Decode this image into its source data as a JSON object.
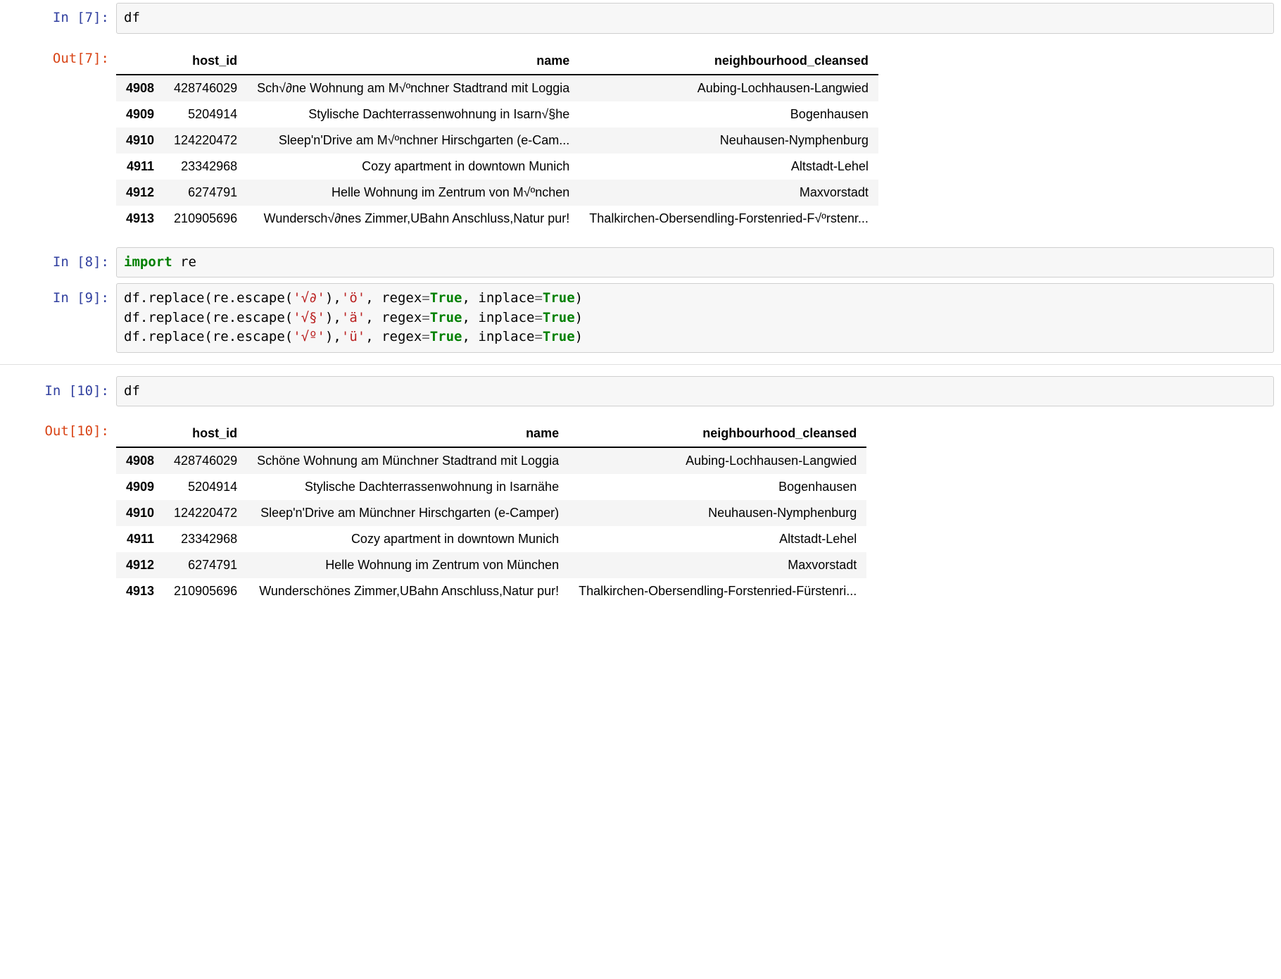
{
  "cells": {
    "c0": {
      "in_prompt": "In [7]:",
      "code_plain": "df",
      "out_prompt": "Out[7]:",
      "table": {
        "columns": [
          "host_id",
          "name",
          "neighbourhood_cleansed"
        ],
        "index": [
          "4908",
          "4909",
          "4910",
          "4911",
          "4912",
          "4913"
        ],
        "rows": [
          [
            "428746029",
            "Sch√∂ne Wohnung am M√ºnchner Stadtrand mit Loggia",
            "Aubing-Lochhausen-Langwied"
          ],
          [
            "5204914",
            "Stylische Dachterrassenwohnung in Isarn√§he",
            "Bogenhausen"
          ],
          [
            "124220472",
            "Sleep'n'Drive am M√ºnchner Hirschgarten (e-Cam...",
            "Neuhausen-Nymphenburg"
          ],
          [
            "23342968",
            "Cozy apartment in downtown Munich",
            "Altstadt-Lehel"
          ],
          [
            "6274791",
            "Helle Wohnung im Zentrum von M√ºnchen",
            "Maxvorstadt"
          ],
          [
            "210905696",
            "Wundersch√∂nes Zimmer,UBahn Anschluss,Natur pur!",
            "Thalkirchen-Obersendling-Forstenried-F√ºrstenr..."
          ]
        ]
      }
    },
    "c1": {
      "in_prompt": "In [8]:",
      "code_tokens": [
        {
          "t": "import",
          "cls": "tok-keyword"
        },
        {
          "t": " re",
          "cls": ""
        }
      ]
    },
    "c2": {
      "in_prompt": "In [9]:",
      "code_lines": [
        [
          {
            "t": "df.replace(re.escape(",
            "cls": ""
          },
          {
            "t": "'√∂'",
            "cls": "tok-string"
          },
          {
            "t": "),",
            "cls": ""
          },
          {
            "t": "'ö'",
            "cls": "tok-string"
          },
          {
            "t": ", regex",
            "cls": ""
          },
          {
            "t": "=",
            "cls": "tok-op"
          },
          {
            "t": "True",
            "cls": "tok-bool"
          },
          {
            "t": ", inplace",
            "cls": ""
          },
          {
            "t": "=",
            "cls": "tok-op"
          },
          {
            "t": "True",
            "cls": "tok-bool"
          },
          {
            "t": ")",
            "cls": ""
          }
        ],
        [
          {
            "t": "df.replace(re.escape(",
            "cls": ""
          },
          {
            "t": "'√§'",
            "cls": "tok-string"
          },
          {
            "t": "),",
            "cls": ""
          },
          {
            "t": "'ä'",
            "cls": "tok-string"
          },
          {
            "t": ", regex",
            "cls": ""
          },
          {
            "t": "=",
            "cls": "tok-op"
          },
          {
            "t": "True",
            "cls": "tok-bool"
          },
          {
            "t": ", inplace",
            "cls": ""
          },
          {
            "t": "=",
            "cls": "tok-op"
          },
          {
            "t": "True",
            "cls": "tok-bool"
          },
          {
            "t": ")",
            "cls": ""
          }
        ],
        [
          {
            "t": "df.replace(re.escape(",
            "cls": ""
          },
          {
            "t": "'√º'",
            "cls": "tok-string"
          },
          {
            "t": "),",
            "cls": ""
          },
          {
            "t": "'ü'",
            "cls": "tok-string"
          },
          {
            "t": ", regex",
            "cls": ""
          },
          {
            "t": "=",
            "cls": "tok-op"
          },
          {
            "t": "True",
            "cls": "tok-bool"
          },
          {
            "t": ", inplace",
            "cls": ""
          },
          {
            "t": "=",
            "cls": "tok-op"
          },
          {
            "t": "True",
            "cls": "tok-bool"
          },
          {
            "t": ")",
            "cls": ""
          }
        ]
      ]
    },
    "c3": {
      "in_prompt": "In [10]:",
      "code_plain": "df",
      "out_prompt": "Out[10]:",
      "table": {
        "columns": [
          "host_id",
          "name",
          "neighbourhood_cleansed"
        ],
        "index": [
          "4908",
          "4909",
          "4910",
          "4911",
          "4912",
          "4913"
        ],
        "rows": [
          [
            "428746029",
            "Schöne Wohnung am Münchner Stadtrand mit Loggia",
            "Aubing-Lochhausen-Langwied"
          ],
          [
            "5204914",
            "Stylische Dachterrassenwohnung in Isarnähe",
            "Bogenhausen"
          ],
          [
            "124220472",
            "Sleep'n'Drive am Münchner Hirschgarten (e-Camper)",
            "Neuhausen-Nymphenburg"
          ],
          [
            "23342968",
            "Cozy apartment in downtown Munich",
            "Altstadt-Lehel"
          ],
          [
            "6274791",
            "Helle Wohnung im Zentrum von München",
            "Maxvorstadt"
          ],
          [
            "210905696",
            "Wunderschönes Zimmer,UBahn Anschluss,Natur pur!",
            "Thalkirchen-Obersendling-Forstenried-Fürstenri..."
          ]
        ]
      }
    }
  }
}
